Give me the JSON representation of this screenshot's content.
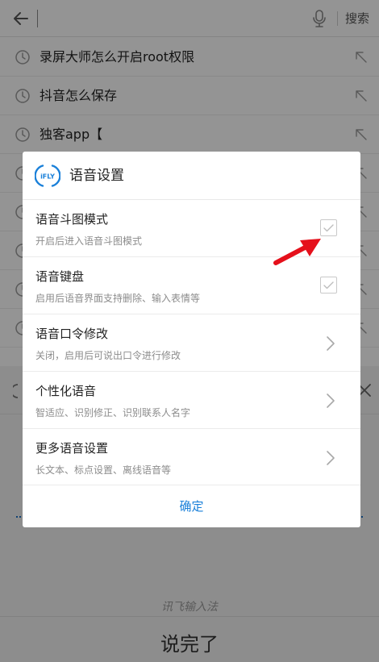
{
  "search_bar": {
    "search_label": "搜索",
    "icons": {
      "back": "arrow-left-icon",
      "mic": "microphone-icon"
    }
  },
  "history": {
    "items": [
      {
        "text": "录屏大师怎么开启root权限"
      },
      {
        "text": "抖音怎么保存"
      },
      {
        "text": "独客app【"
      },
      {
        "text": ""
      },
      {
        "text": ""
      },
      {
        "text": ""
      },
      {
        "text": ""
      },
      {
        "text": ""
      }
    ],
    "icons": {
      "history": "clock-icon",
      "fill": "arrow-up-left-icon"
    }
  },
  "dialog": {
    "logo_text": "iFLY",
    "title": "语音设置",
    "settings": [
      {
        "title": "语音斗图模式",
        "subtitle": "开启后进入语音斗图模式",
        "control": "checkbox",
        "checked": true
      },
      {
        "title": "语音键盘",
        "subtitle": "启用后语音界面支持删除、输入表情等",
        "control": "checkbox",
        "checked": true
      },
      {
        "title": "语音口令修改",
        "subtitle": "关闭，启用后可说出口令进行修改",
        "control": "chevron"
      },
      {
        "title": "个性化语音",
        "subtitle": "智适应、识别修正、识别联系人名字",
        "control": "chevron"
      },
      {
        "title": "更多语音设置",
        "subtitle": "长文本、标点设置、离线语音等",
        "control": "chevron"
      }
    ],
    "confirm_label": "确定"
  },
  "keyboard": {
    "brand_watermark": "讯飞输入法",
    "done_label": "说完了"
  },
  "colors": {
    "accent": "#1a80d9",
    "annotation_arrow": "#e5101b",
    "overlay": "rgba(0,0,0,0.42)"
  }
}
